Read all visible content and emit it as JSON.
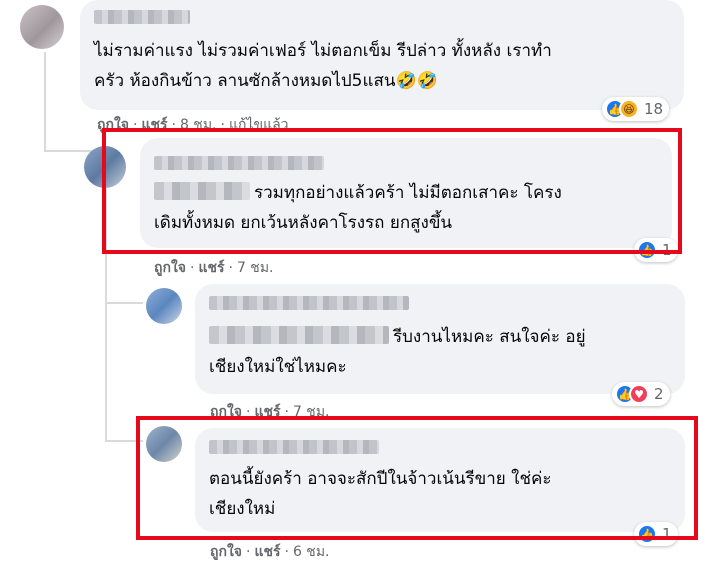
{
  "comments": [
    {
      "text_line1": "ไม่รามค่าแรง ไม่รวมค่าเฟอร์ ไม่ตอกเข็ม รีปล่าว ทั้งหลัง เราทำ",
      "text_line2": "ครัว ห้องกินข้าว ลานซักล้างหมดไป5แสน🤣🤣",
      "like_label": "ถูกใจ",
      "share_label": "แชร์",
      "time": "8 ชม.",
      "edited": "แก้ไขแล้ว",
      "reactions": [
        "like",
        "haha"
      ],
      "reaction_count": "18"
    },
    {
      "text_line1": "รวมทุกอย่างแล้วคร้า ไม่มีตอกเสาคะ โครง",
      "text_line2": "เดิมทั้งหมด ยกเว้นหลังคาโรงรถ ยกสูงขึ้น",
      "like_label": "ถูกใจ",
      "share_label": "แชร์",
      "time": "7 ชม.",
      "reactions": [
        "like"
      ],
      "reaction_count": "1"
    },
    {
      "text_line1": "รีบงานไหมคะ สนใจค่ะ อยู่",
      "text_line2": "เชียงใหม่ใช่ไหมคะ",
      "like_label": "ถูกใจ",
      "share_label": "แชร์",
      "time": "7 ชม.",
      "reactions": [
        "like",
        "love"
      ],
      "reaction_count": "2"
    },
    {
      "text_line1": "ตอนนี้ยังคร้า อาจจะสักปีในจ้าวเน้นรีขาย ใช่ค่ะ",
      "text_line2": "เชียงใหม่",
      "like_label": "ถูกใจ",
      "share_label": "แชร์",
      "time": "6 ชม.",
      "reactions": [
        "like"
      ],
      "reaction_count": "1"
    }
  ],
  "colors": {
    "bubble": "#f0f2f5",
    "highlight": "#e5091b",
    "like": "#1877f2",
    "love": "#f33e58",
    "haha": "#f7b125",
    "meta": "#65676b"
  }
}
